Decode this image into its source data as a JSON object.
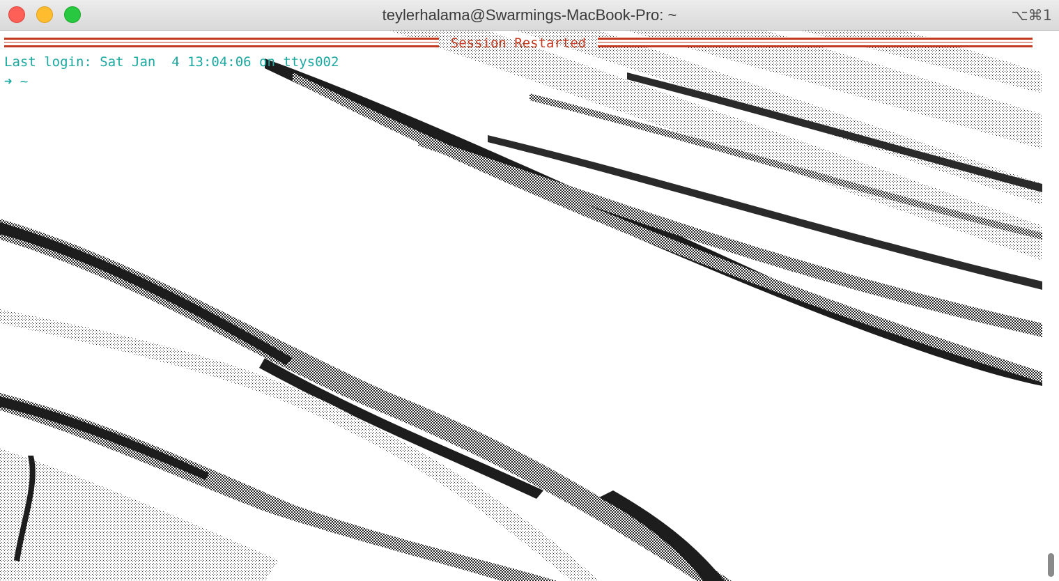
{
  "window": {
    "title": "teylerhalama@Swarmings-MacBook-Pro: ~",
    "shortcut": "⌥⌘1"
  },
  "terminal": {
    "banner": "Session Restarted",
    "login_line": "Last login: Sat Jan  4 13:04:06 on ttys002",
    "prompt": "➜ ~"
  },
  "colors": {
    "banner": "#c2391f",
    "prompt": "#1aa8a0",
    "close": "#fe5f57",
    "minimize": "#febc2e",
    "maximize": "#28c840"
  },
  "background_image": "rock-strata-dithered"
}
